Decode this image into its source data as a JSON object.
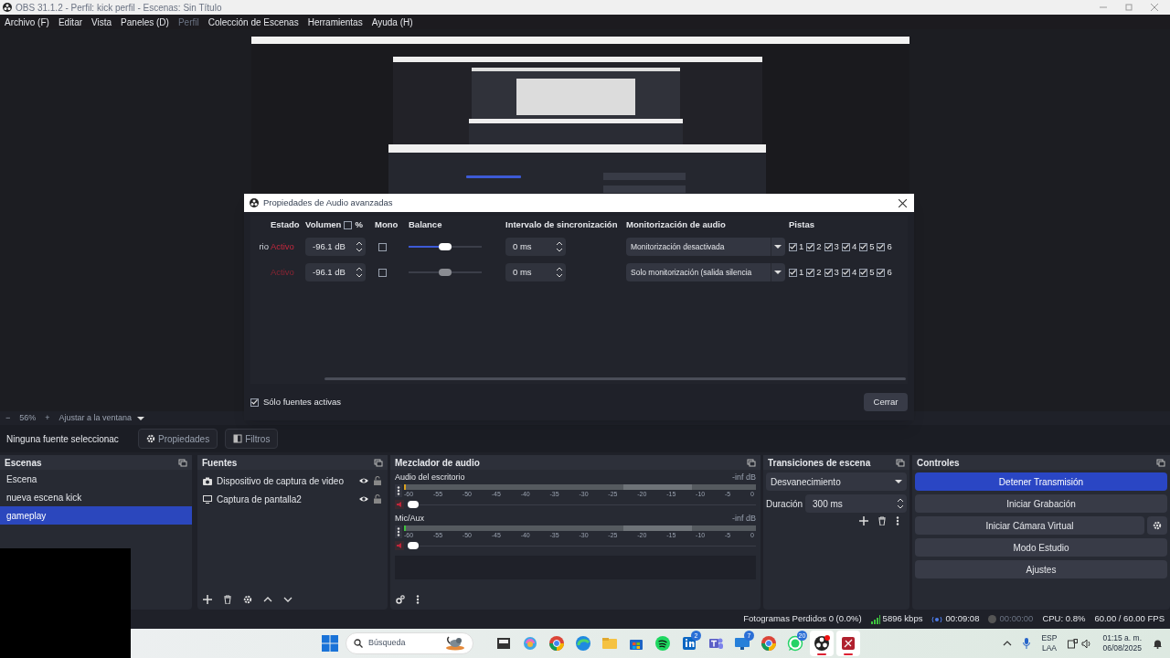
{
  "window": {
    "title": "OBS 31.1.2 - Perfil: kick perfil - Escenas: Sin Título"
  },
  "menu": [
    {
      "label": "Archivo (F)",
      "disabled": false
    },
    {
      "label": "Editar",
      "disabled": false
    },
    {
      "label": "Vista",
      "disabled": false
    },
    {
      "label": "Paneles (D)",
      "disabled": false
    },
    {
      "label": "Perfil",
      "disabled": true
    },
    {
      "label": "Colección de Escenas",
      "disabled": false
    },
    {
      "label": "Herramientas",
      "disabled": false
    },
    {
      "label": "Ayuda (H)",
      "disabled": false
    }
  ],
  "preview": {
    "zoom_out": "−",
    "zoom": "56%",
    "zoom_in": "+",
    "fit": "Ajustar a la ventana"
  },
  "dialog": {
    "title": "Propiedades de Audio avanzadas",
    "columns": {
      "status": "Estado",
      "volume": "Volumen",
      "percent": "%",
      "percent_checked": false,
      "mono": "Mono",
      "balance": "Balance",
      "sync": "Intervalo de sincronización",
      "monitoring": "Monitorización de audio",
      "tracks": "Pistas"
    },
    "rows": [
      {
        "name": "rio",
        "status": "Activo",
        "volume": "-96.1 dB",
        "mono": false,
        "balance": {
          "level": 0.5
        },
        "disabled": false,
        "sync": "0 ms",
        "monitoring": "Monitorización desactivada",
        "tracks": [
          {
            "label": "1",
            "checked": true
          },
          {
            "label": "2",
            "checked": true
          },
          {
            "label": "3",
            "checked": true
          },
          {
            "label": "4",
            "checked": true
          },
          {
            "label": "5",
            "checked": true
          },
          {
            "label": "6",
            "checked": true
          }
        ]
      },
      {
        "status": "Activo",
        "volume": "-96.1 dB",
        "mono": false,
        "balance": {
          "level": 0.5
        },
        "disabled": true,
        "sync": "0 ms",
        "monitoring": "Solo monitorización (salida silencia",
        "tracks": [
          {
            "label": "1",
            "checked": true
          },
          {
            "label": "2",
            "checked": true
          },
          {
            "label": "3",
            "checked": true
          },
          {
            "label": "4",
            "checked": true
          },
          {
            "label": "5",
            "checked": true
          },
          {
            "label": "6",
            "checked": true
          }
        ]
      }
    ],
    "active_only": {
      "label": "Sólo fuentes activas",
      "checked": true
    },
    "close": "Cerrar"
  },
  "source_bar": {
    "label": "Ninguna fuente seleccionac",
    "properties": "Propiedades",
    "filters": "Filtros"
  },
  "scenes": {
    "title": "Escenas",
    "items": [
      {
        "label": "Escena",
        "selected": false
      },
      {
        "label": "nueva escena kick",
        "selected": false
      },
      {
        "label": "gameplay",
        "selected": true
      }
    ]
  },
  "sources": {
    "title": "Fuentes",
    "items": [
      {
        "label": "Dispositivo de captura de video",
        "kind": "camera",
        "visible": true,
        "locked": false
      },
      {
        "label": "Captura de pantalla2",
        "kind": "display",
        "visible": true,
        "locked": false
      }
    ]
  },
  "mixer": {
    "title": "Mezclador de audio",
    "channels": [
      {
        "name": "Audio del escritorio",
        "reading": "-inf dB",
        "muted": true,
        "volume": {
          "level": 0
        },
        "scale": [
          "-60",
          "-55",
          "-50",
          "-45",
          "-40",
          "-35",
          "-30",
          "-25",
          "-20",
          "-15",
          "-10",
          "-5",
          "0"
        ]
      },
      {
        "name": "Mic/Aux",
        "reading": "-inf dB",
        "muted": true,
        "volume": {
          "level": 0
        },
        "scale": [
          "-60",
          "-55",
          "-50",
          "-45",
          "-40",
          "-35",
          "-30",
          "-25",
          "-20",
          "-15",
          "-10",
          "-5",
          "0"
        ]
      }
    ]
  },
  "transitions": {
    "title": "Transiciones de escena",
    "type": "Desvanecimiento",
    "duration_label": "Duración",
    "duration": "300 ms"
  },
  "controls": {
    "title": "Controles",
    "buttons": [
      {
        "label": "Detener Transmisión",
        "active": true,
        "settings": false
      },
      {
        "label": "Iniciar Grabación",
        "active": false,
        "settings": false
      },
      {
        "label": "Iniciar Cámara Virtual",
        "active": false,
        "settings": true
      },
      {
        "label": "Modo Estudio",
        "active": false,
        "settings": false
      },
      {
        "label": "Ajustes",
        "active": false,
        "settings": false
      }
    ]
  },
  "status_bar": {
    "dropped": "Fotogramas Perdidos 0 (0.0%)",
    "bitrate": "5896 kbps",
    "stream_time": "00:09:08",
    "record_time": "00:00:00",
    "cpu": "CPU: 0.8%",
    "fps": "60.00 / 60.00 FPS"
  },
  "taskbar": {
    "search": {
      "placeholder": "Búsqueda"
    },
    "apps": [
      {
        "active": false
      },
      {
        "active": false
      },
      {
        "active": false
      },
      {
        "active": false
      },
      {
        "active": false
      },
      {
        "active": false
      },
      {
        "active": false
      },
      {
        "active": false,
        "badge": "2"
      },
      {
        "active": false
      },
      {
        "active": false,
        "badge": "7"
      },
      {
        "active": false
      },
      {
        "active": false,
        "badge": "20"
      },
      {
        "active": true
      },
      {
        "active": true
      }
    ],
    "lang": "ESP",
    "layout": "LAA",
    "time": "01:15 a. m.",
    "date": "06/08/2025"
  }
}
